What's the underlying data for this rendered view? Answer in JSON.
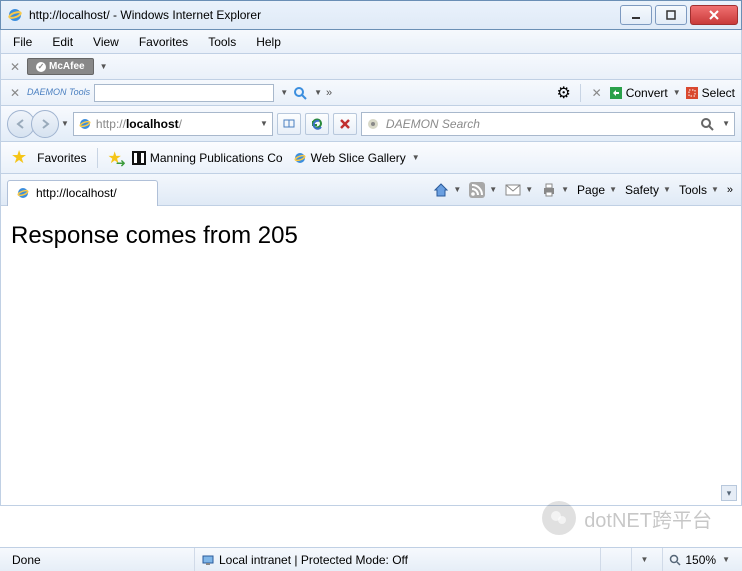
{
  "window": {
    "title": "http://localhost/ - Windows Internet Explorer"
  },
  "menu": {
    "file": "File",
    "edit": "Edit",
    "view": "View",
    "favorites": "Favorites",
    "tools": "Tools",
    "help": "Help"
  },
  "mcafee": {
    "label": "McAfee"
  },
  "daemon": {
    "label": "DAEMON Tools"
  },
  "convert": {
    "label": "Convert",
    "select": "Select"
  },
  "address": {
    "prefix": "http://",
    "host": "localhost",
    "suffix": "/"
  },
  "search": {
    "placeholder": "DAEMON Search"
  },
  "favoritesBar": {
    "label": "Favorites",
    "items": [
      {
        "label": "Manning Publications Co"
      },
      {
        "label": "Web Slice Gallery"
      }
    ]
  },
  "tab": {
    "title": "http://localhost/"
  },
  "commands": {
    "page": "Page",
    "safety": "Safety",
    "tools": "Tools"
  },
  "page": {
    "body": "Response comes from 205"
  },
  "status": {
    "done": "Done",
    "zone": "Local intranet | Protected Mode: Off",
    "zoom": "150%"
  },
  "watermark": {
    "text": "dotNET跨平台"
  }
}
